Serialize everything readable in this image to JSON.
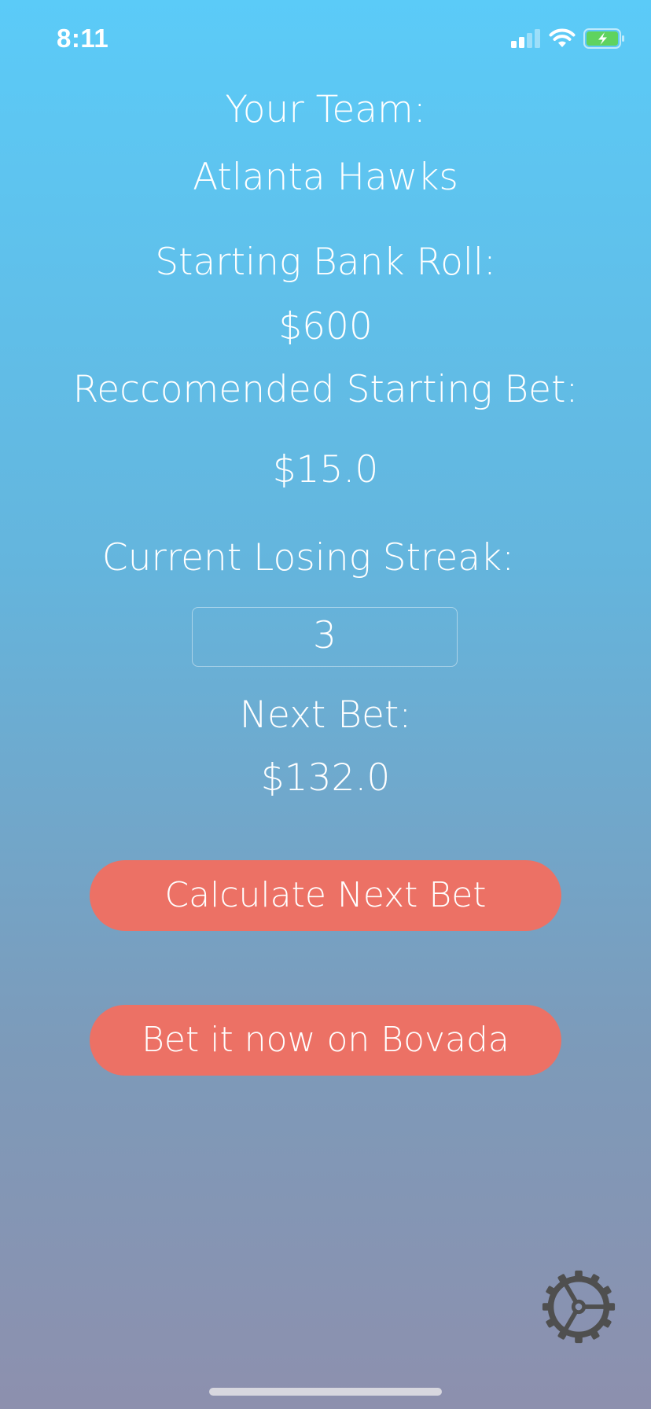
{
  "status_bar": {
    "time": "8:11"
  },
  "labels": {
    "team_label": "Your Team:",
    "team_name": "Atlanta Hawks",
    "bankroll_label": "Starting Bank Roll:",
    "bankroll_value": "$600",
    "starting_bet_label": "Reccomended Starting Bet:",
    "starting_bet_value": "$15.0",
    "losing_streak_label": "Current Losing Streak:",
    "next_bet_label": "Next Bet:",
    "next_bet_value": "$132.0"
  },
  "inputs": {
    "losing_streak_value": "3"
  },
  "buttons": {
    "calculate_label": "Calculate Next Bet",
    "bovada_label": "Bet it now on Bovada"
  },
  "icons": {
    "signal": "cellular-signal-icon",
    "wifi": "wifi-icon",
    "battery": "battery-charging-icon",
    "settings": "gear-icon"
  },
  "colors": {
    "button": "#ec7165",
    "gradient_top": "#5bcbf8",
    "gradient_bottom": "#8d90ae",
    "gear": "#4f4f4f"
  }
}
